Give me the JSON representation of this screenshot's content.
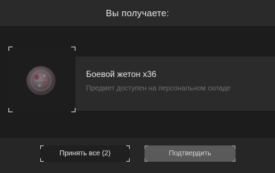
{
  "dialog": {
    "title": "Вы получаете:"
  },
  "reward": {
    "icon": "token-icon",
    "name": "Боевой жетон x36",
    "description": "Предмет доступен на персональном складе"
  },
  "buttons": {
    "accept_all_label": "Принять все (2)",
    "confirm_label": "Подтвердить"
  },
  "colors": {
    "background": "#262626",
    "band": "#1c1c1c",
    "row": "#2b2b2b",
    "confirm_button": "#5a5a5a"
  }
}
